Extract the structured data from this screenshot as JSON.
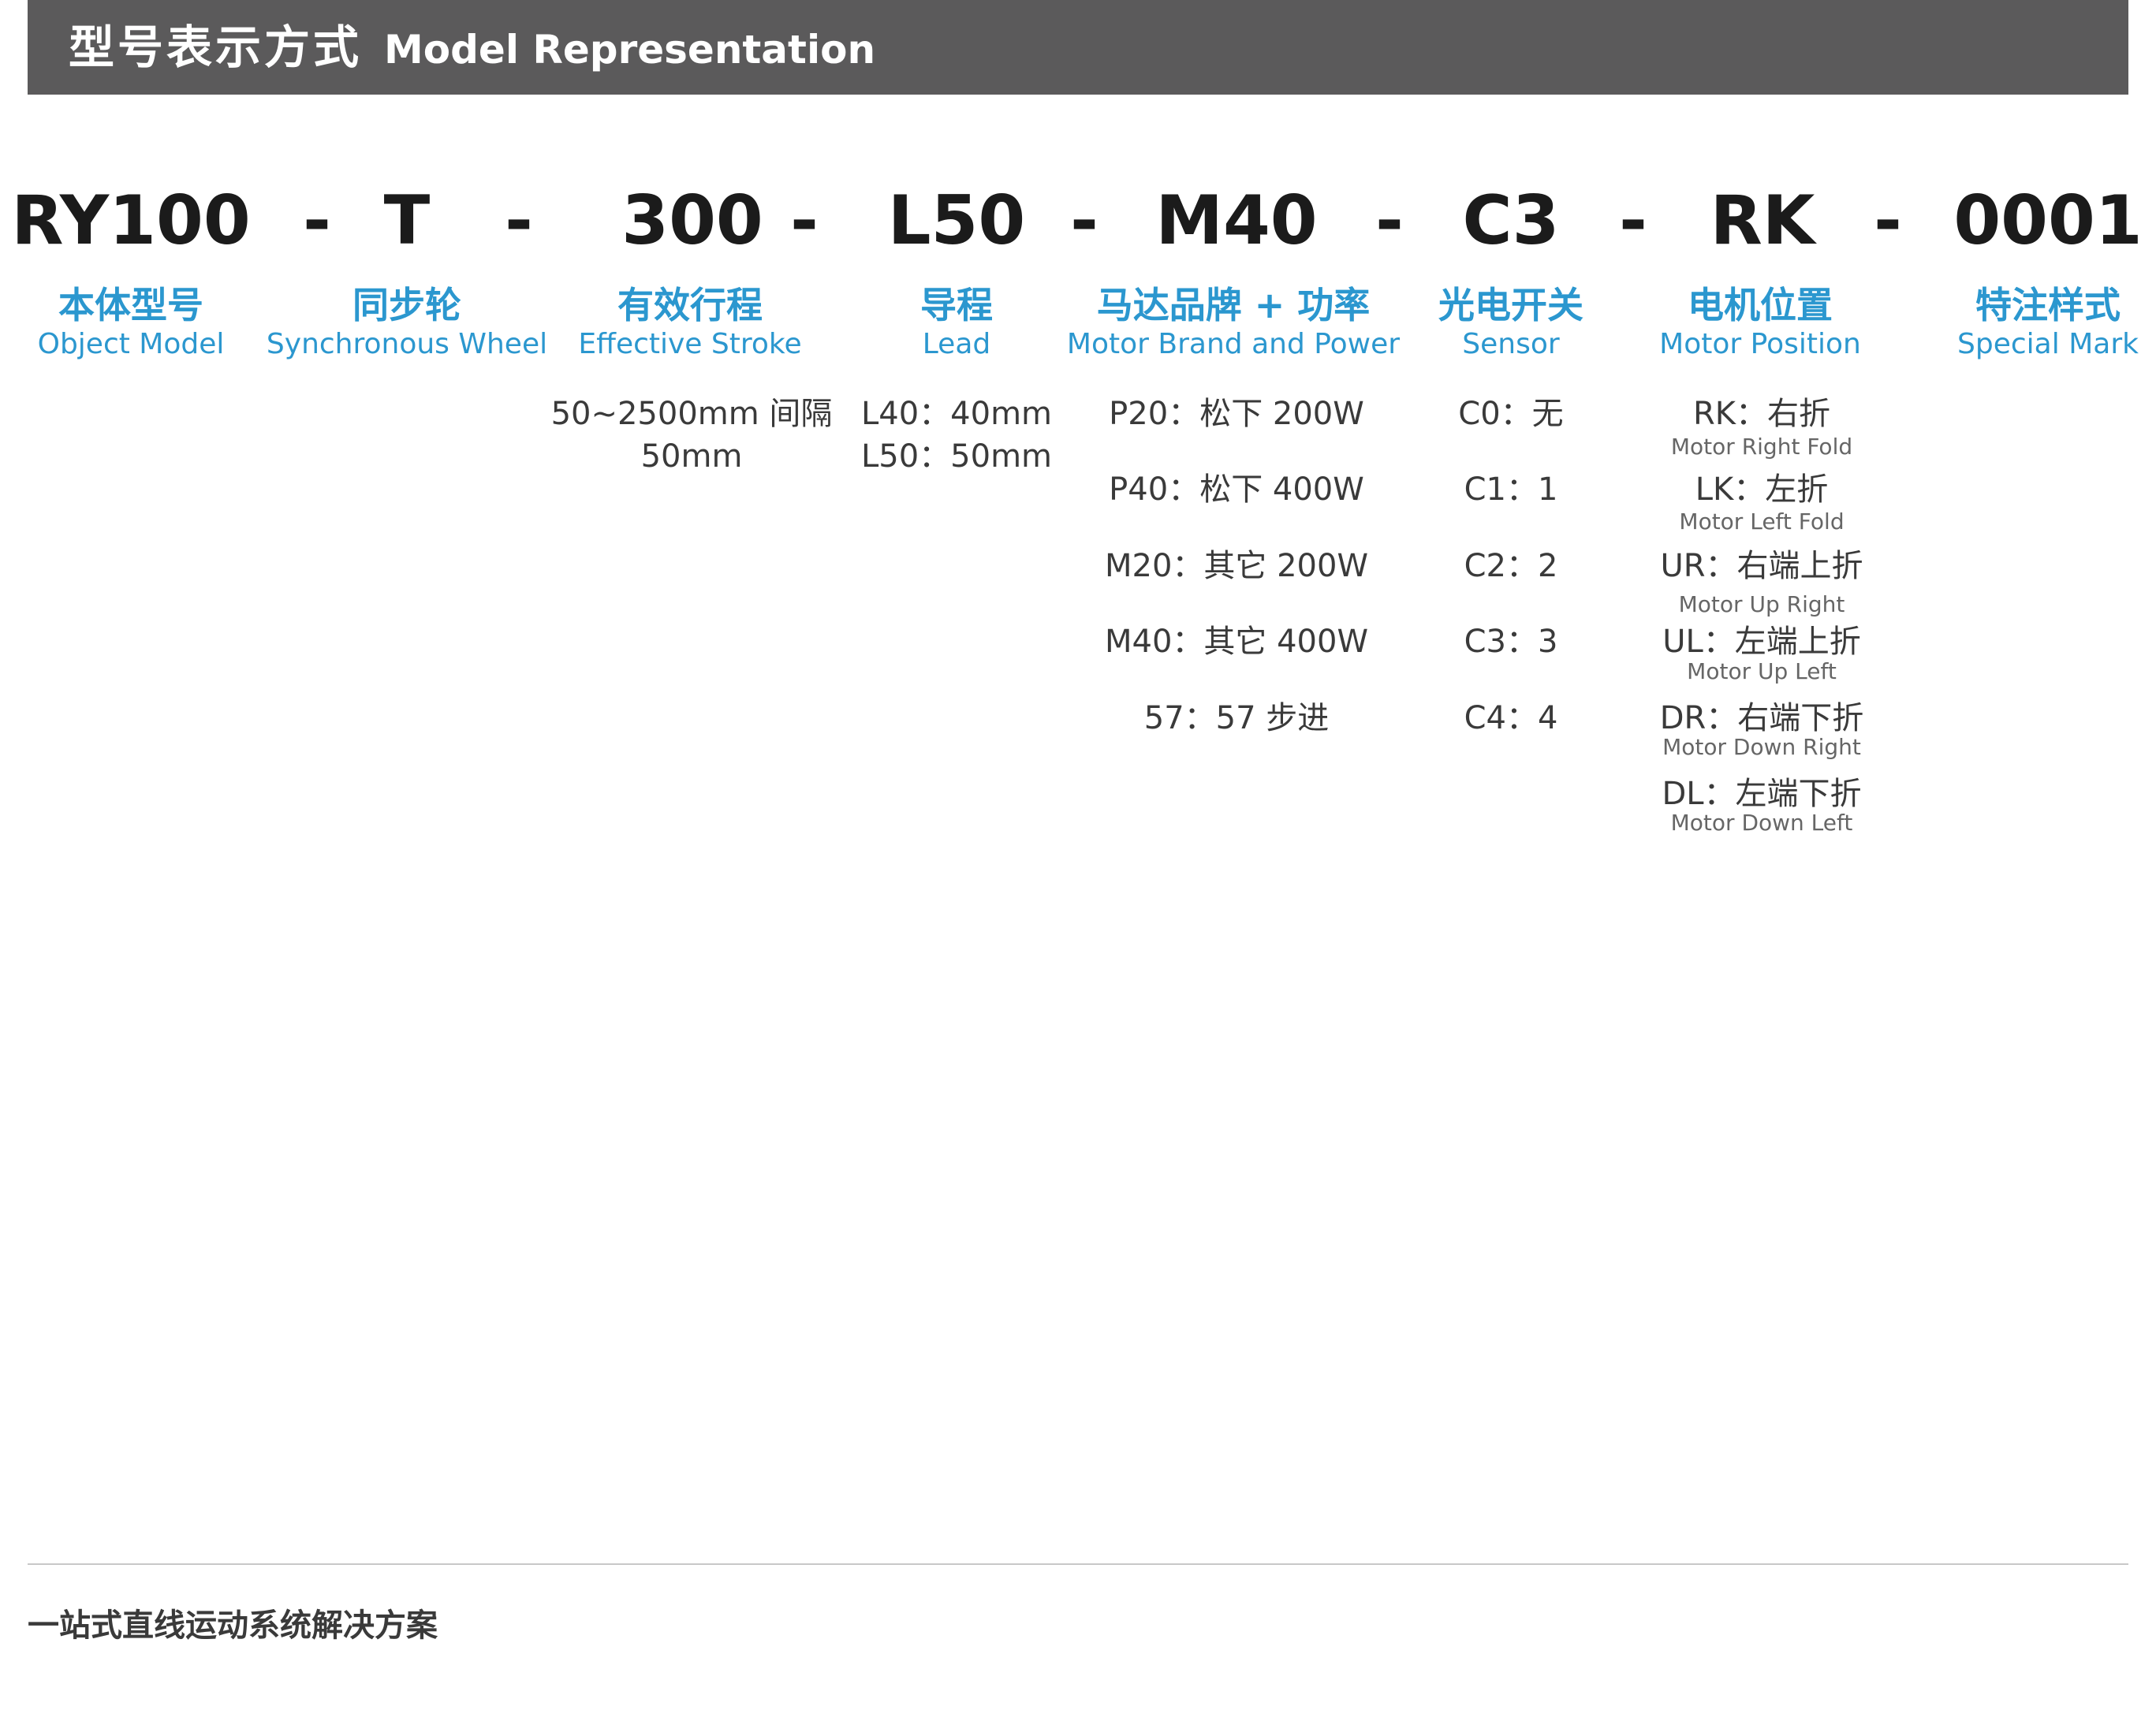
{
  "header": {
    "title_cn": "型号表示方式",
    "title_en": "Model Representation"
  },
  "model": {
    "codes": [
      "RY100",
      "T",
      "300",
      "L50",
      "M40",
      "C3",
      "RK",
      "0001"
    ],
    "separator": "-"
  },
  "categories": [
    {
      "cn": "本体型号",
      "en": "Object Model"
    },
    {
      "cn": "同步轮",
      "en": "Synchronous Wheel"
    },
    {
      "cn": "有效行程",
      "en": "Effective Stroke"
    },
    {
      "cn": "导程",
      "en": "Lead"
    },
    {
      "cn": "马达品牌 + 功率",
      "en": "Motor Brand and Power"
    },
    {
      "cn": "光电开关",
      "en": "Sensor"
    },
    {
      "cn": "电机位置",
      "en": "Motor Position"
    },
    {
      "cn": "特注样式",
      "en": "Special Mark"
    }
  ],
  "stroke": {
    "line1": "50~2500mm 间隔",
    "line2": "50mm"
  },
  "lead": [
    "L40：40mm",
    "L50：50mm"
  ],
  "motor": [
    "P20：松下 200W",
    "P40：松下 400W",
    "M20：其它 200W",
    "M40：其它 400W",
    "57：57 步进"
  ],
  "sensor": [
    "C0：无",
    "C1：1",
    "C2：2",
    "C3：3",
    "C4：4"
  ],
  "position": [
    {
      "label": "RK：右折",
      "sub": "Motor Right Fold"
    },
    {
      "label": "LK：左折",
      "sub": "Motor Left Fold"
    },
    {
      "label": "UR：右端上折",
      "sub": "Motor Up Right"
    },
    {
      "label": "UL：左端上折",
      "sub": "Motor Up Left"
    },
    {
      "label": "DR：右端下折",
      "sub": "Motor Down Right"
    },
    {
      "label": "DL：左端下折",
      "sub": "Motor Down Left"
    }
  ],
  "footer": {
    "text": "一站式直线运动系统解决方案"
  }
}
